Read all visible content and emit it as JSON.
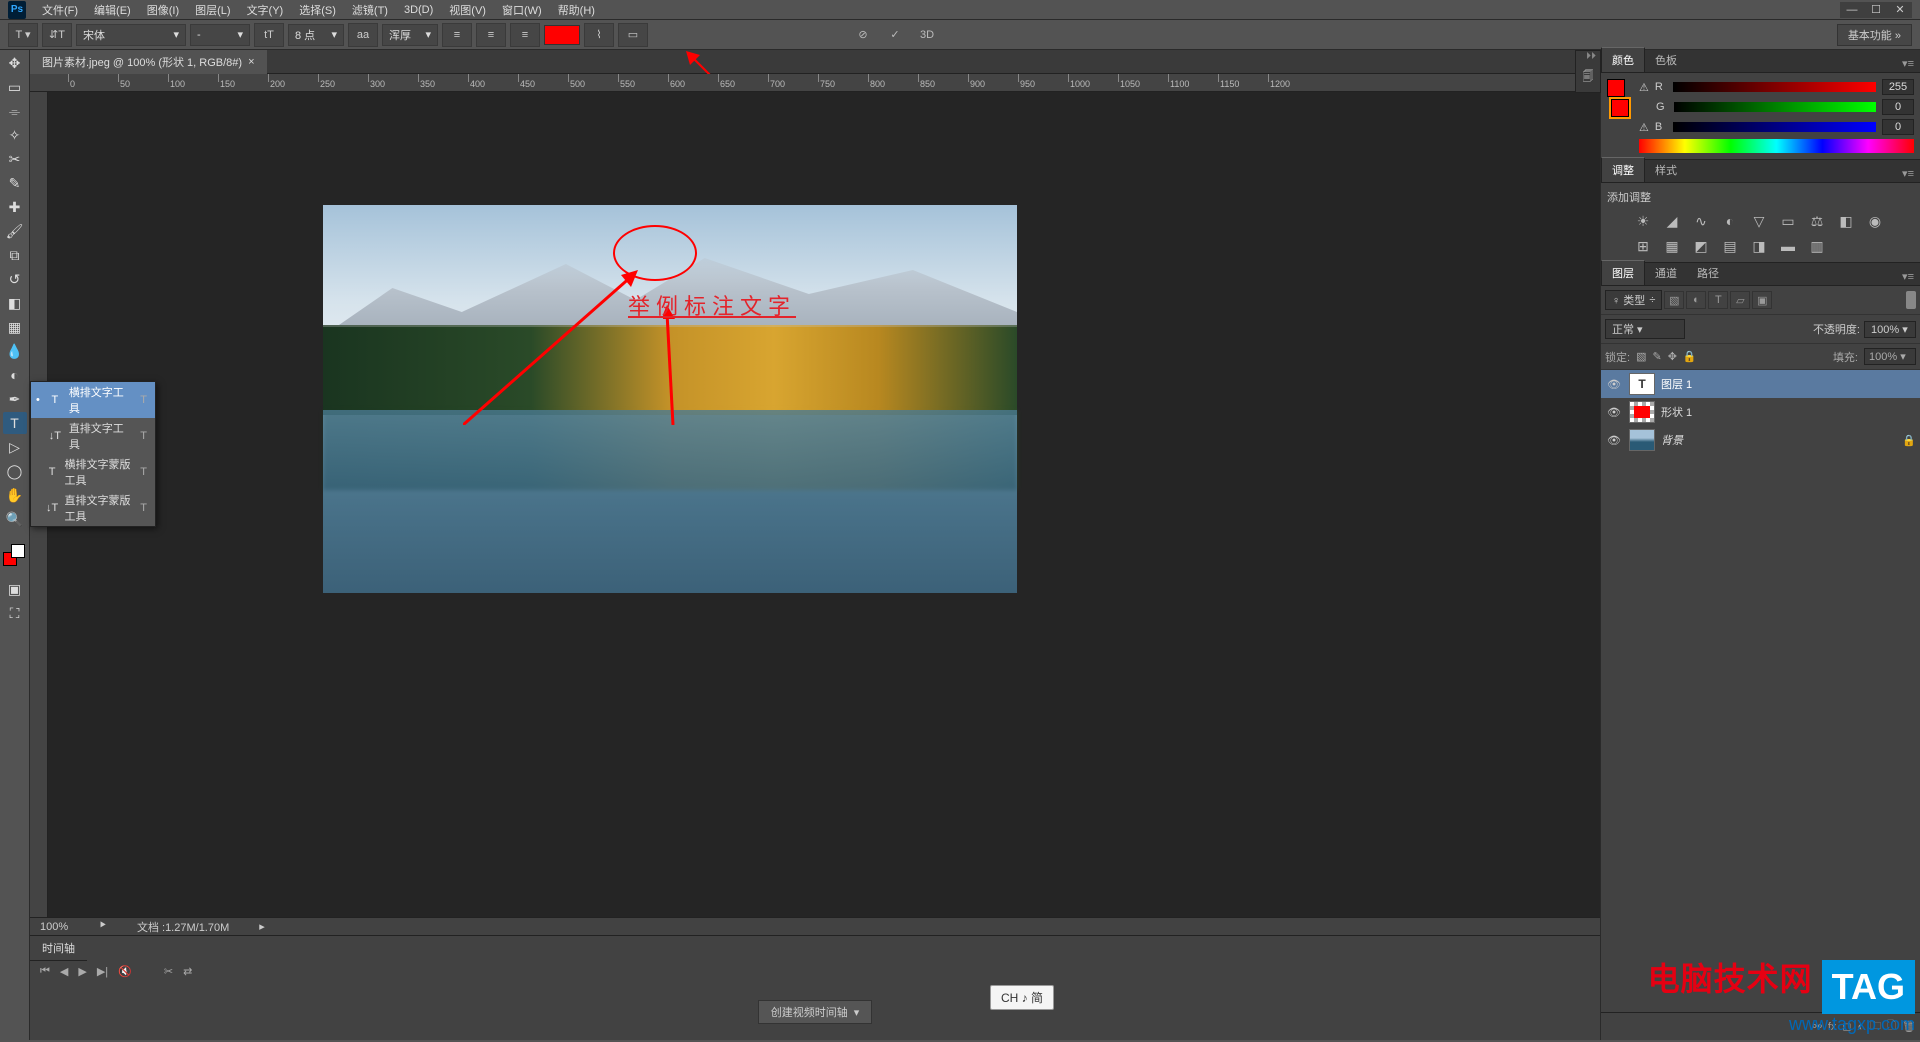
{
  "menubar": {
    "items": [
      "文件(F)",
      "编辑(E)",
      "图像(I)",
      "图层(L)",
      "文字(Y)",
      "选择(S)",
      "滤镜(T)",
      "3D(D)",
      "视图(V)",
      "窗口(W)",
      "帮助(H)"
    ]
  },
  "options": {
    "font_family": "宋体",
    "font_style": "-",
    "font_size": "8 点",
    "aa_label": "aa",
    "aa_value": "浑厚",
    "badge": "基本功能",
    "threeD": "3D"
  },
  "doc_tab": {
    "title": "图片素材.jpeg @ 100% (形状 1, RGB/8#)",
    "close": "×"
  },
  "ruler_marks": [
    0,
    50,
    100,
    150,
    200,
    250,
    300,
    350,
    400,
    450,
    500,
    550,
    600,
    650,
    700,
    750,
    800,
    850,
    900,
    950,
    1000,
    1050,
    1100,
    1150,
    1200
  ],
  "annotation_text": "举例标注文字",
  "flyout": {
    "items": [
      {
        "icon": "T",
        "label": "横排文字工具",
        "key": "T",
        "selected": true
      },
      {
        "icon": "↓T",
        "label": "直排文字工具",
        "key": "T",
        "selected": false
      },
      {
        "icon": "T",
        "label": "横排文字蒙版工具",
        "key": "T",
        "selected": false
      },
      {
        "icon": "↓T",
        "label": "直排文字蒙版工具",
        "key": "T",
        "selected": false
      }
    ]
  },
  "status": {
    "zoom": "100%",
    "doc_info": "文档 :1.27M/1.70M"
  },
  "timeline": {
    "tab": "时间轴",
    "button": "创建视频时间轴"
  },
  "ime": "CH ♪ 简",
  "watermark": {
    "cn": "电脑技术网",
    "url": "www.tagxp.com",
    "tag": "TAG"
  },
  "panels": {
    "color": {
      "tabs": [
        "颜色",
        "色板"
      ],
      "r": {
        "label": "R",
        "val": "255"
      },
      "g": {
        "label": "G",
        "val": "0"
      },
      "b": {
        "label": "B",
        "val": "0"
      }
    },
    "adjust": {
      "tabs": [
        "调整",
        "样式"
      ],
      "add_label": "添加调整"
    },
    "layers": {
      "tabs": [
        "图层",
        "通道",
        "路径"
      ],
      "filter_kind": "♀ 类型",
      "blend_mode": "正常",
      "opacity_label": "不透明度:",
      "opacity_val": "100%",
      "lock_label": "锁定:",
      "fill_label": "填充:",
      "fill_val": "100%",
      "rows": [
        {
          "name": "图层 1",
          "type": "text",
          "selected": true
        },
        {
          "name": "形状 1",
          "type": "shape",
          "selected": false
        },
        {
          "name": "背景",
          "type": "img",
          "locked": true,
          "selected": false
        }
      ]
    }
  }
}
